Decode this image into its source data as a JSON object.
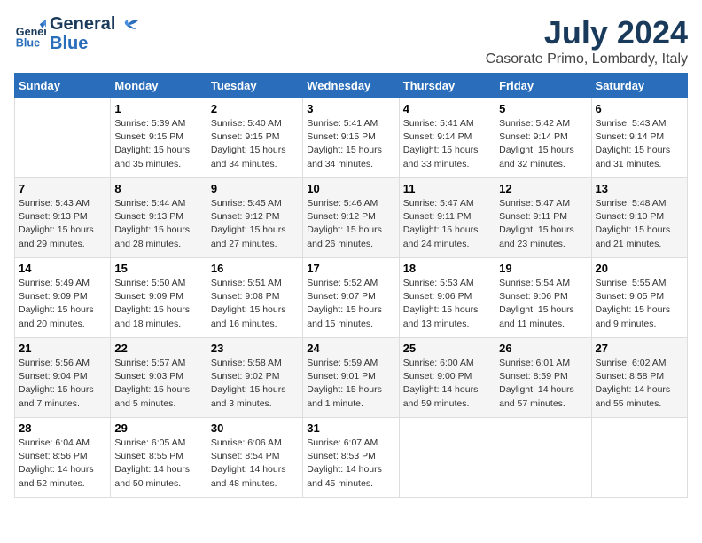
{
  "header": {
    "logo_general": "General",
    "logo_blue": "Blue",
    "title": "July 2024",
    "subtitle": "Casorate Primo, Lombardy, Italy"
  },
  "weekdays": [
    "Sunday",
    "Monday",
    "Tuesday",
    "Wednesday",
    "Thursday",
    "Friday",
    "Saturday"
  ],
  "weeks": [
    [
      {
        "day": "",
        "info": ""
      },
      {
        "day": "1",
        "info": "Sunrise: 5:39 AM\nSunset: 9:15 PM\nDaylight: 15 hours\nand 35 minutes."
      },
      {
        "day": "2",
        "info": "Sunrise: 5:40 AM\nSunset: 9:15 PM\nDaylight: 15 hours\nand 34 minutes."
      },
      {
        "day": "3",
        "info": "Sunrise: 5:41 AM\nSunset: 9:15 PM\nDaylight: 15 hours\nand 34 minutes."
      },
      {
        "day": "4",
        "info": "Sunrise: 5:41 AM\nSunset: 9:14 PM\nDaylight: 15 hours\nand 33 minutes."
      },
      {
        "day": "5",
        "info": "Sunrise: 5:42 AM\nSunset: 9:14 PM\nDaylight: 15 hours\nand 32 minutes."
      },
      {
        "day": "6",
        "info": "Sunrise: 5:43 AM\nSunset: 9:14 PM\nDaylight: 15 hours\nand 31 minutes."
      }
    ],
    [
      {
        "day": "7",
        "info": "Sunrise: 5:43 AM\nSunset: 9:13 PM\nDaylight: 15 hours\nand 29 minutes."
      },
      {
        "day": "8",
        "info": "Sunrise: 5:44 AM\nSunset: 9:13 PM\nDaylight: 15 hours\nand 28 minutes."
      },
      {
        "day": "9",
        "info": "Sunrise: 5:45 AM\nSunset: 9:12 PM\nDaylight: 15 hours\nand 27 minutes."
      },
      {
        "day": "10",
        "info": "Sunrise: 5:46 AM\nSunset: 9:12 PM\nDaylight: 15 hours\nand 26 minutes."
      },
      {
        "day": "11",
        "info": "Sunrise: 5:47 AM\nSunset: 9:11 PM\nDaylight: 15 hours\nand 24 minutes."
      },
      {
        "day": "12",
        "info": "Sunrise: 5:47 AM\nSunset: 9:11 PM\nDaylight: 15 hours\nand 23 minutes."
      },
      {
        "day": "13",
        "info": "Sunrise: 5:48 AM\nSunset: 9:10 PM\nDaylight: 15 hours\nand 21 minutes."
      }
    ],
    [
      {
        "day": "14",
        "info": "Sunrise: 5:49 AM\nSunset: 9:09 PM\nDaylight: 15 hours\nand 20 minutes."
      },
      {
        "day": "15",
        "info": "Sunrise: 5:50 AM\nSunset: 9:09 PM\nDaylight: 15 hours\nand 18 minutes."
      },
      {
        "day": "16",
        "info": "Sunrise: 5:51 AM\nSunset: 9:08 PM\nDaylight: 15 hours\nand 16 minutes."
      },
      {
        "day": "17",
        "info": "Sunrise: 5:52 AM\nSunset: 9:07 PM\nDaylight: 15 hours\nand 15 minutes."
      },
      {
        "day": "18",
        "info": "Sunrise: 5:53 AM\nSunset: 9:06 PM\nDaylight: 15 hours\nand 13 minutes."
      },
      {
        "day": "19",
        "info": "Sunrise: 5:54 AM\nSunset: 9:06 PM\nDaylight: 15 hours\nand 11 minutes."
      },
      {
        "day": "20",
        "info": "Sunrise: 5:55 AM\nSunset: 9:05 PM\nDaylight: 15 hours\nand 9 minutes."
      }
    ],
    [
      {
        "day": "21",
        "info": "Sunrise: 5:56 AM\nSunset: 9:04 PM\nDaylight: 15 hours\nand 7 minutes."
      },
      {
        "day": "22",
        "info": "Sunrise: 5:57 AM\nSunset: 9:03 PM\nDaylight: 15 hours\nand 5 minutes."
      },
      {
        "day": "23",
        "info": "Sunrise: 5:58 AM\nSunset: 9:02 PM\nDaylight: 15 hours\nand 3 minutes."
      },
      {
        "day": "24",
        "info": "Sunrise: 5:59 AM\nSunset: 9:01 PM\nDaylight: 15 hours\nand 1 minute."
      },
      {
        "day": "25",
        "info": "Sunrise: 6:00 AM\nSunset: 9:00 PM\nDaylight: 14 hours\nand 59 minutes."
      },
      {
        "day": "26",
        "info": "Sunrise: 6:01 AM\nSunset: 8:59 PM\nDaylight: 14 hours\nand 57 minutes."
      },
      {
        "day": "27",
        "info": "Sunrise: 6:02 AM\nSunset: 8:58 PM\nDaylight: 14 hours\nand 55 minutes."
      }
    ],
    [
      {
        "day": "28",
        "info": "Sunrise: 6:04 AM\nSunset: 8:56 PM\nDaylight: 14 hours\nand 52 minutes."
      },
      {
        "day": "29",
        "info": "Sunrise: 6:05 AM\nSunset: 8:55 PM\nDaylight: 14 hours\nand 50 minutes."
      },
      {
        "day": "30",
        "info": "Sunrise: 6:06 AM\nSunset: 8:54 PM\nDaylight: 14 hours\nand 48 minutes."
      },
      {
        "day": "31",
        "info": "Sunrise: 6:07 AM\nSunset: 8:53 PM\nDaylight: 14 hours\nand 45 minutes."
      },
      {
        "day": "",
        "info": ""
      },
      {
        "day": "",
        "info": ""
      },
      {
        "day": "",
        "info": ""
      }
    ]
  ]
}
